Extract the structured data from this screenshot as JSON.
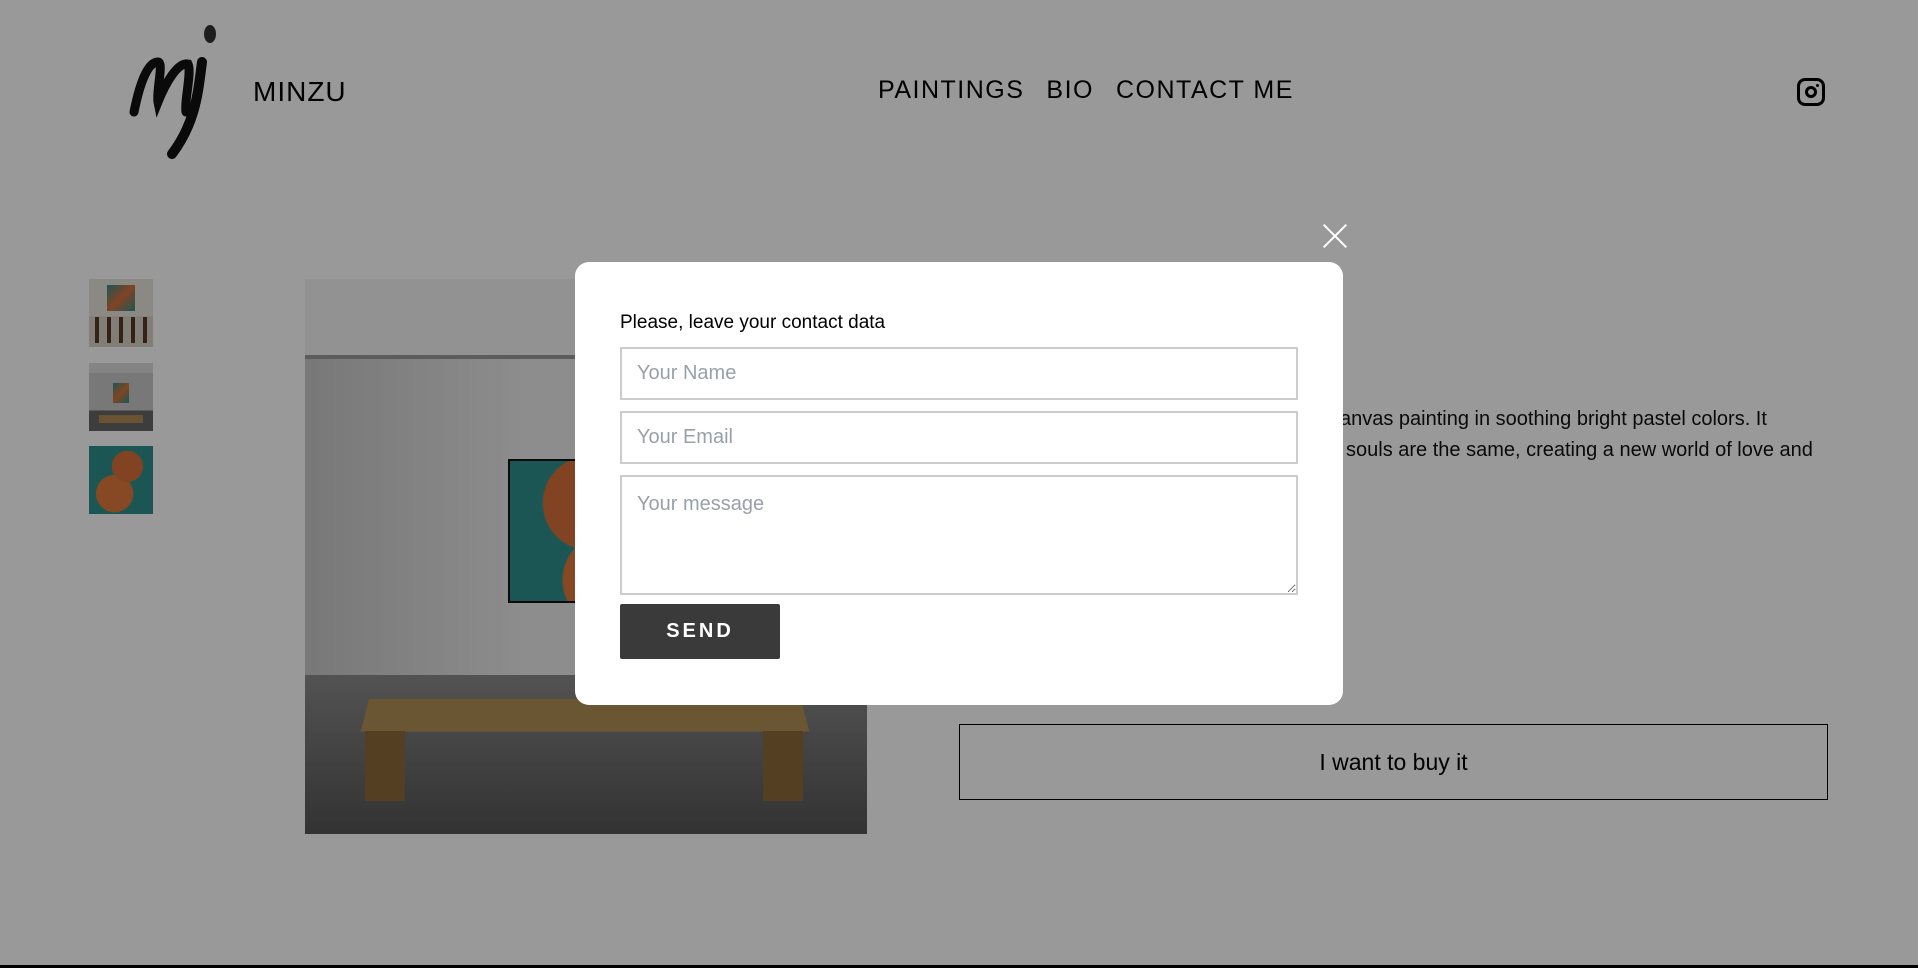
{
  "header": {
    "brand": "MINZU",
    "nav": [
      "PAINTINGS",
      "BIO",
      "CONTACT ME"
    ],
    "social_icon": "instagram-icon"
  },
  "product": {
    "description_lines": [
      "anvas painting in soothing bright pastel colors. It",
      "souls are the same, creating a new world of love and"
    ],
    "buy_label": "I want to buy it"
  },
  "modal": {
    "label": "Please, leave your contact data",
    "name_placeholder": "Your Name",
    "email_placeholder": "Your Email",
    "message_placeholder": "Your message",
    "send_label": "SEND",
    "close_icon": "close-icon"
  },
  "colors": {
    "overlay": "#999999",
    "send_button": "#3a3a3a",
    "placeholder": "#9aa0ab"
  }
}
